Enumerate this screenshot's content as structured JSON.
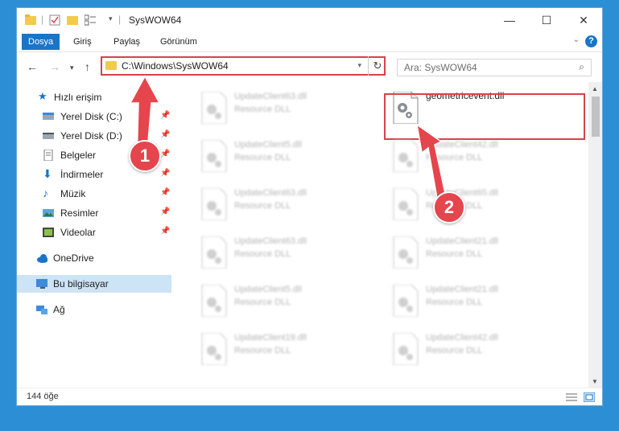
{
  "window": {
    "title": "SysWOW64",
    "controls": {
      "minimize": "—",
      "maximize": "☐",
      "close": "✕"
    }
  },
  "ribbon": {
    "tabs": [
      "Dosya",
      "Giriş",
      "Paylaş",
      "Görünüm"
    ],
    "help": "?"
  },
  "nav": {
    "address": "C:\\Windows\\SysWOW64",
    "search_placeholder": "Ara: SysWOW64"
  },
  "sidebar": {
    "quick_access": "Hızlı erişim",
    "items": [
      {
        "label": "Yerel Disk (C:)",
        "icon": "drive-icon"
      },
      {
        "label": "Yerel Disk (D:)",
        "icon": "drive-icon"
      },
      {
        "label": "Belgeler",
        "icon": "documents-icon"
      },
      {
        "label": "İndirmeler",
        "icon": "downloads-icon"
      },
      {
        "label": "Müzik",
        "icon": "music-icon"
      },
      {
        "label": "Resimler",
        "icon": "pictures-icon"
      },
      {
        "label": "Videolar",
        "icon": "videos-icon"
      }
    ],
    "onedrive": "OneDrive",
    "this_pc": "Bu bilgisayar",
    "network": "Ağ"
  },
  "files": {
    "highlighted": {
      "name": "geometricevent.dll"
    },
    "left_column": [
      {
        "name": "UpdateClient63.dll",
        "type": "Resource DLL"
      },
      {
        "name": "UpdateClient5.dll",
        "type": "Resource DLL"
      },
      {
        "name": "UpdateClient63.dll",
        "type": "Resource DLL"
      },
      {
        "name": "UpdateClient63.dll",
        "type": "Resource DLL"
      },
      {
        "name": "UpdateClient5.dll",
        "type": "Resource DLL"
      },
      {
        "name": "UpdateClient19.dll",
        "type": "Resource DLL"
      }
    ],
    "right_column": [
      {
        "name": "UpdateClient42.dll",
        "type": "Resource DLL"
      },
      {
        "name": "UpdateClient65.dll",
        "type": "Resource DLL"
      },
      {
        "name": "UpdateClient21.dll",
        "type": "Resource DLL"
      },
      {
        "name": "UpdateClient21.dll",
        "type": "Resource DLL"
      },
      {
        "name": "UpdateClient42.dll",
        "type": "Resource DLL"
      }
    ]
  },
  "status": {
    "count": "144 öğe"
  },
  "callouts": [
    "1",
    "2"
  ],
  "colors": {
    "accent": "#1a74c8",
    "highlight": "#d9414b",
    "selection": "#cde3f6"
  }
}
